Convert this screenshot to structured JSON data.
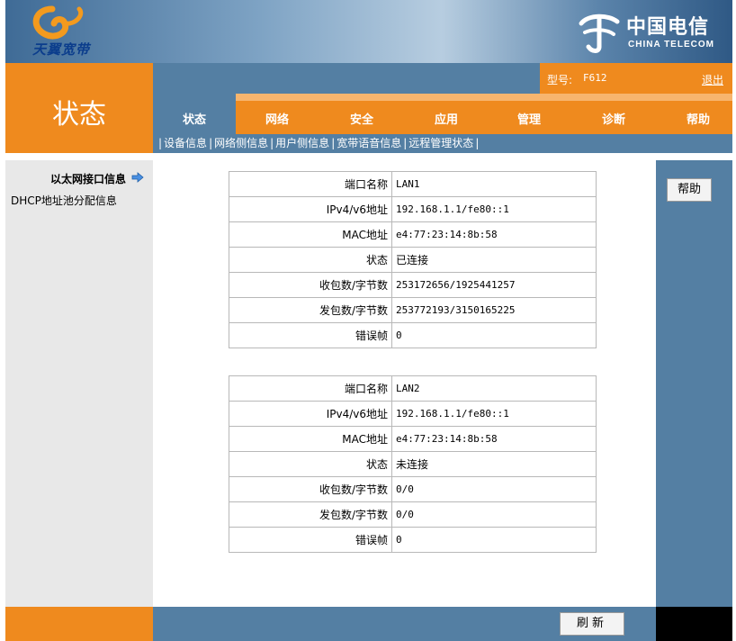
{
  "brand": {
    "left_logo_text": "天翼宽带",
    "right_logo_cn": "中国电信",
    "right_logo_en": "CHINA TELECOM"
  },
  "header": {
    "page_title": "状态",
    "model_label": "型号:",
    "model_value": "F612",
    "logout": "退出"
  },
  "tabs": [
    {
      "label": "状态",
      "active": true
    },
    {
      "label": "网络"
    },
    {
      "label": "安全"
    },
    {
      "label": "应用"
    },
    {
      "label": "管理"
    },
    {
      "label": "诊断"
    },
    {
      "label": "帮助"
    }
  ],
  "subnav": [
    {
      "label": "设备信息"
    },
    {
      "label": "网络侧信息"
    },
    {
      "label": "用户侧信息",
      "active": true
    },
    {
      "label": "宽带语音信息"
    },
    {
      "label": "远程管理状态"
    }
  ],
  "sidebar": {
    "items": [
      {
        "label": "以太网接口信息",
        "active": true
      },
      {
        "label": "DHCP地址池分配信息"
      }
    ]
  },
  "ports": [
    {
      "rows": [
        {
          "key": "端口名称",
          "value": "LAN1"
        },
        {
          "key": "IPv4/v6地址",
          "value": "192.168.1.1/fe80::1"
        },
        {
          "key": "MAC地址",
          "value": "e4:77:23:14:8b:58"
        },
        {
          "key": "状态",
          "value": "已连接"
        },
        {
          "key": "收包数/字节数",
          "value": "253172656/1925441257"
        },
        {
          "key": "发包数/字节数",
          "value": "253772193/3150165225"
        },
        {
          "key": "错误帧",
          "value": "0"
        }
      ]
    },
    {
      "rows": [
        {
          "key": "端口名称",
          "value": "LAN2"
        },
        {
          "key": "IPv4/v6地址",
          "value": "192.168.1.1/fe80::1"
        },
        {
          "key": "MAC地址",
          "value": "e4:77:23:14:8b:58"
        },
        {
          "key": "状态",
          "value": "未连接"
        },
        {
          "key": "收包数/字节数",
          "value": "0/0"
        },
        {
          "key": "发包数/字节数",
          "value": "0/0"
        },
        {
          "key": "错误帧",
          "value": "0"
        }
      ]
    }
  ],
  "buttons": {
    "help": "帮助",
    "refresh": "刷新"
  },
  "colors": {
    "orange": "#ef8a1e",
    "steel_blue": "#547fa3",
    "sidebar_gray": "#e8e8e8"
  }
}
